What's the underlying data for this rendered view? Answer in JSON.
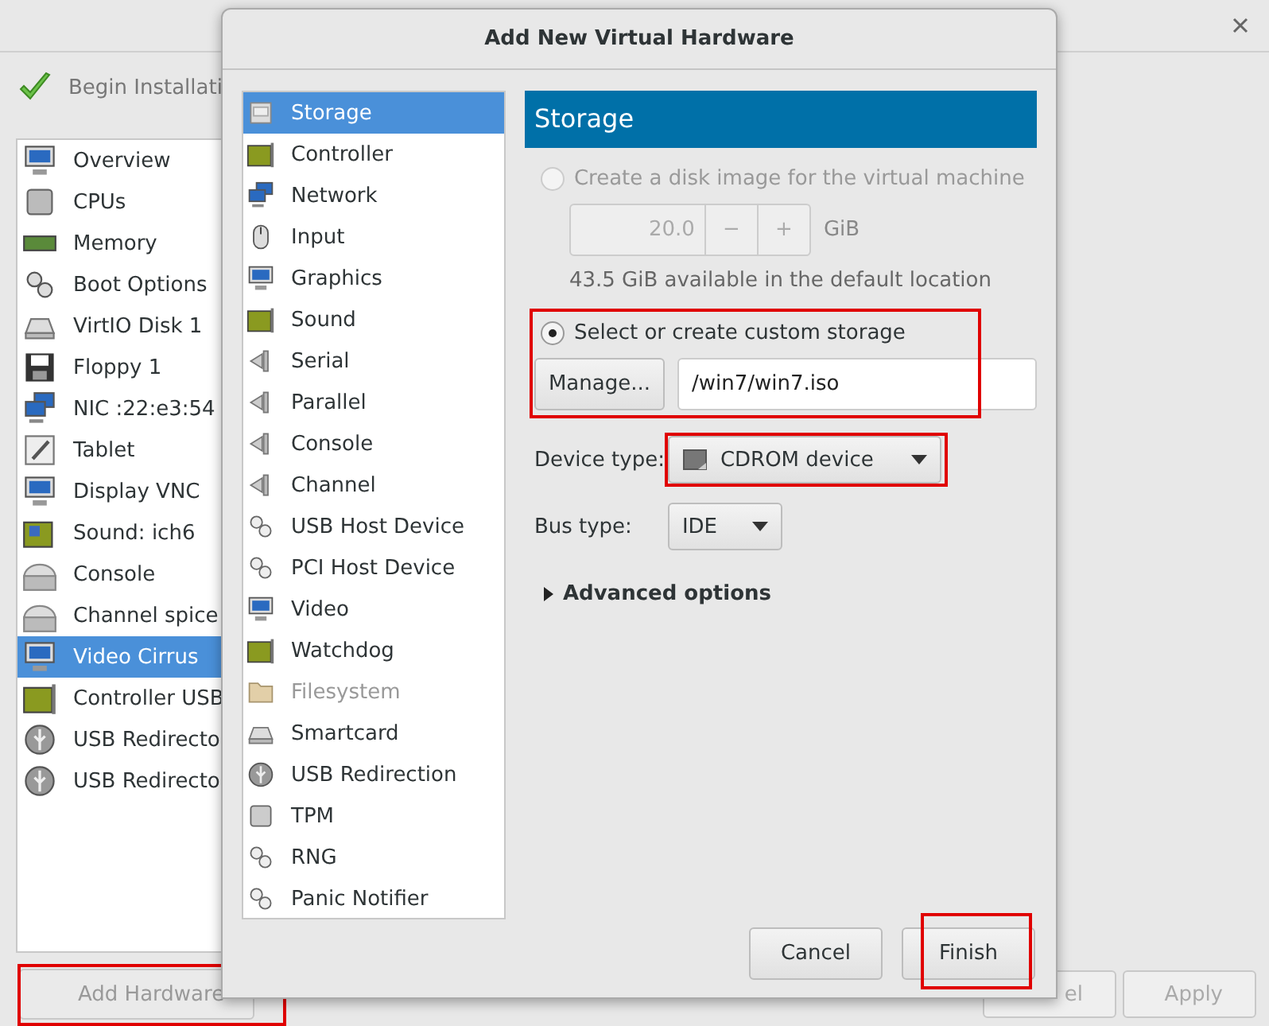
{
  "main_window": {
    "begin_installation": "Begin Installati",
    "hardware_list": [
      {
        "label": "Overview",
        "selected": false
      },
      {
        "label": "CPUs",
        "selected": false
      },
      {
        "label": "Memory",
        "selected": false
      },
      {
        "label": "Boot Options",
        "selected": false
      },
      {
        "label": "VirtIO Disk 1",
        "selected": false
      },
      {
        "label": "Floppy 1",
        "selected": false
      },
      {
        "label": "NIC :22:e3:54",
        "selected": false
      },
      {
        "label": "Tablet",
        "selected": false
      },
      {
        "label": "Display VNC",
        "selected": false
      },
      {
        "label": "Sound: ich6",
        "selected": false
      },
      {
        "label": "Console",
        "selected": false
      },
      {
        "label": "Channel spice",
        "selected": false
      },
      {
        "label": "Video Cirrus",
        "selected": true
      },
      {
        "label": "Controller USB",
        "selected": false
      },
      {
        "label": "USB Redirecto",
        "selected": false
      },
      {
        "label": "USB Redirecto",
        "selected": false
      }
    ],
    "add_hardware": {
      "label": "Add Hardware",
      "disabled": true,
      "highlighted": true
    },
    "buttons": [
      {
        "label": "el",
        "disabled": true
      },
      {
        "label": "Apply",
        "disabled": true
      }
    ]
  },
  "dialog": {
    "title": "Add New Virtual Hardware",
    "device_list": [
      {
        "label": "Storage",
        "selected": true,
        "disabled": false
      },
      {
        "label": "Controller",
        "selected": false,
        "disabled": false
      },
      {
        "label": "Network",
        "selected": false,
        "disabled": false
      },
      {
        "label": "Input",
        "selected": false,
        "disabled": false
      },
      {
        "label": "Graphics",
        "selected": false,
        "disabled": false
      },
      {
        "label": "Sound",
        "selected": false,
        "disabled": false
      },
      {
        "label": "Serial",
        "selected": false,
        "disabled": false
      },
      {
        "label": "Parallel",
        "selected": false,
        "disabled": false
      },
      {
        "label": "Console",
        "selected": false,
        "disabled": false
      },
      {
        "label": "Channel",
        "selected": false,
        "disabled": false
      },
      {
        "label": "USB Host Device",
        "selected": false,
        "disabled": false
      },
      {
        "label": "PCI Host Device",
        "selected": false,
        "disabled": false
      },
      {
        "label": "Video",
        "selected": false,
        "disabled": false
      },
      {
        "label": "Watchdog",
        "selected": false,
        "disabled": false
      },
      {
        "label": "Filesystem",
        "selected": false,
        "disabled": true
      },
      {
        "label": "Smartcard",
        "selected": false,
        "disabled": false
      },
      {
        "label": "USB Redirection",
        "selected": false,
        "disabled": false
      },
      {
        "label": "TPM",
        "selected": false,
        "disabled": false
      },
      {
        "label": "RNG",
        "selected": false,
        "disabled": false
      },
      {
        "label": "Panic Notifier",
        "selected": false,
        "disabled": false
      }
    ],
    "panel_title": "Storage",
    "create_disk": {
      "label": "Create a disk image for the virtual machine",
      "selected": false,
      "disabled": true,
      "size": "20.0",
      "minus": "−",
      "plus": "+",
      "unit": "GiB",
      "note": "43.5 GiB available in the default location"
    },
    "custom_storage": {
      "label": "Select or create custom storage",
      "selected": true,
      "highlighted": true,
      "manage": "Manage...",
      "path": "/win7/win7.iso"
    },
    "device_type": {
      "label": "Device type:",
      "value": "CDROM device",
      "highlighted": true
    },
    "bus_type": {
      "label": "Bus type:",
      "value": "IDE"
    },
    "advanced": {
      "label": "Advanced options",
      "expanded": false
    },
    "cancel": {
      "label": "Cancel"
    },
    "finish": {
      "label": "Finish",
      "highlighted": true
    }
  }
}
